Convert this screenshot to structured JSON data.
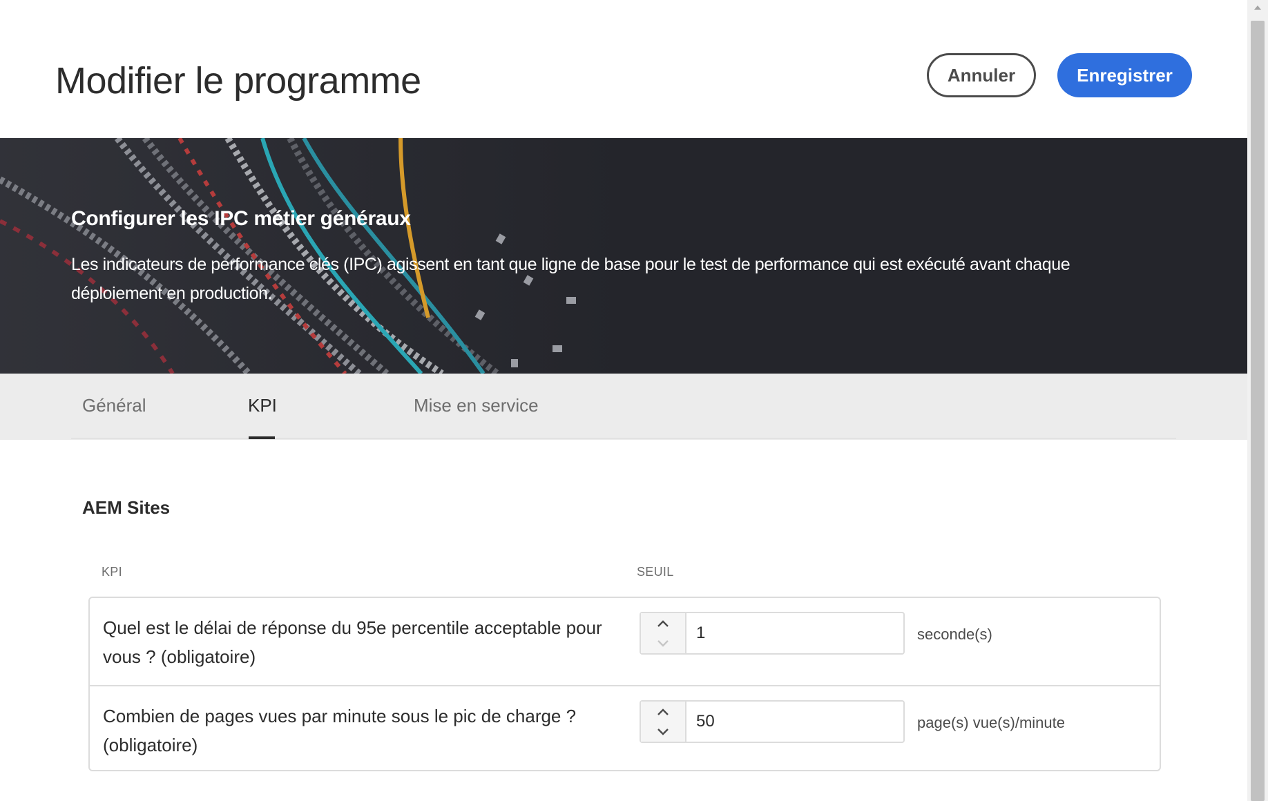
{
  "header": {
    "title": "Modifier le programme",
    "cancel_label": "Annuler",
    "save_label": "Enregistrer"
  },
  "banner": {
    "title": "Configurer les IPC métier généraux",
    "description": "Les indicateurs de performance clés (IPC) agissent en tant que ligne de base pour le test de performance qui est exécuté avant chaque déploiement en production."
  },
  "tabs": [
    {
      "label": "Général",
      "active": false
    },
    {
      "label": "KPI",
      "active": true
    },
    {
      "label": "Mise en service",
      "active": false
    }
  ],
  "section": {
    "title": "AEM Sites",
    "columns": {
      "kpi": "KPI",
      "threshold": "SEUIL"
    },
    "rows": [
      {
        "question": "Quel est le délai de réponse du 95e percentile acceptable pour vous ? (obligatoire)",
        "value": "1",
        "unit": "seconde(s)"
      },
      {
        "question": "Combien de pages vues par minute sous le pic de charge ? (obligatoire)",
        "value": "50",
        "unit": "page(s) vue(s)/minute"
      }
    ]
  },
  "colors": {
    "accent": "#2f6fde",
    "banner_bg": "#24252b",
    "tabbar_bg": "#ececec"
  },
  "icons": [
    "chevron-up-icon",
    "chevron-down-icon"
  ]
}
